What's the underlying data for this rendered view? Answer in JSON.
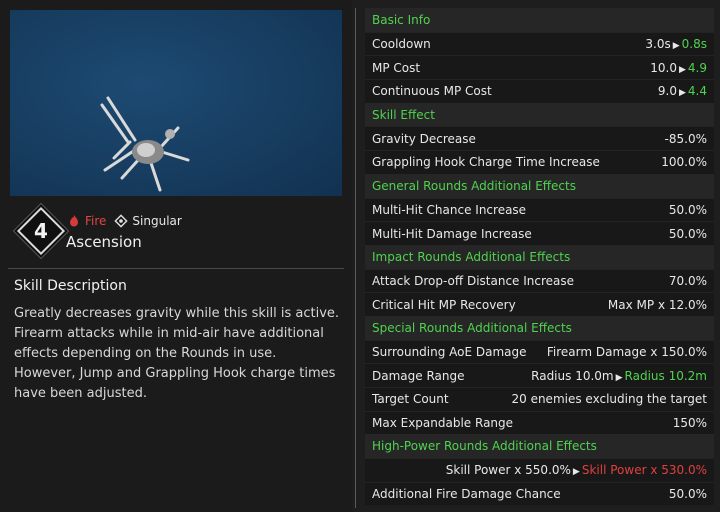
{
  "skill": {
    "rank": "4",
    "element": "Fire",
    "type": "Singular",
    "name": "Ascension"
  },
  "description": {
    "title": "Skill Description",
    "body": "Greatly decreases gravity while this skill is active. Firearm attacks while in mid-air have additional effects depending on the Rounds in use. However, Jump and Grappling Hook charge times have been adjusted."
  },
  "colors": {
    "section": "#4fd34f",
    "up": "#4fd34f",
    "down": "#e04040",
    "fire": "#e04545"
  },
  "stats": {
    "basic_info": "Basic Info",
    "cooldown": {
      "label": "Cooldown",
      "old": "3.0s",
      "new": "0.8s"
    },
    "mp_cost": {
      "label": "MP Cost",
      "old": "10.0",
      "new": "4.9"
    },
    "continuous_mp": {
      "label": "Continuous MP Cost",
      "old": "9.0",
      "new": "4.4"
    },
    "skill_effect": "Skill Effect",
    "gravity": {
      "label": "Gravity Decrease",
      "value": "-85.0%"
    },
    "grapple": {
      "label": "Grappling Hook Charge Time Increase",
      "value": "100.0%"
    },
    "general_rounds": "General Rounds Additional Effects",
    "multi_chance": {
      "label": "Multi-Hit Chance Increase",
      "value": "50.0%"
    },
    "multi_damage": {
      "label": "Multi-Hit Damage Increase",
      "value": "50.0%"
    },
    "impact_rounds": "Impact Rounds Additional Effects",
    "dropoff": {
      "label": "Attack Drop-off Distance Increase",
      "value": "70.0%"
    },
    "crit_mp": {
      "label": "Critical Hit MP Recovery",
      "value": "Max MP x 12.0%"
    },
    "special_rounds": "Special Rounds Additional Effects",
    "aoe": {
      "label": "Surrounding AoE Damage",
      "value": "Firearm Damage x 150.0%"
    },
    "damage_range": {
      "label": "Damage Range",
      "old": "Radius 10.0m",
      "new": "Radius 10.2m"
    },
    "target_count": {
      "label": "Target Count",
      "value": "20 enemies excluding the target"
    },
    "max_range": {
      "label": "Max Expandable Range",
      "value": "150%"
    },
    "high_power": "High-Power Rounds Additional Effects",
    "skill_power": {
      "old": "Skill Power x 550.0%",
      "new": "Skill Power x 530.0%"
    },
    "fire_chance": {
      "label": "Additional Fire Damage Chance",
      "value": "50.0%"
    }
  }
}
